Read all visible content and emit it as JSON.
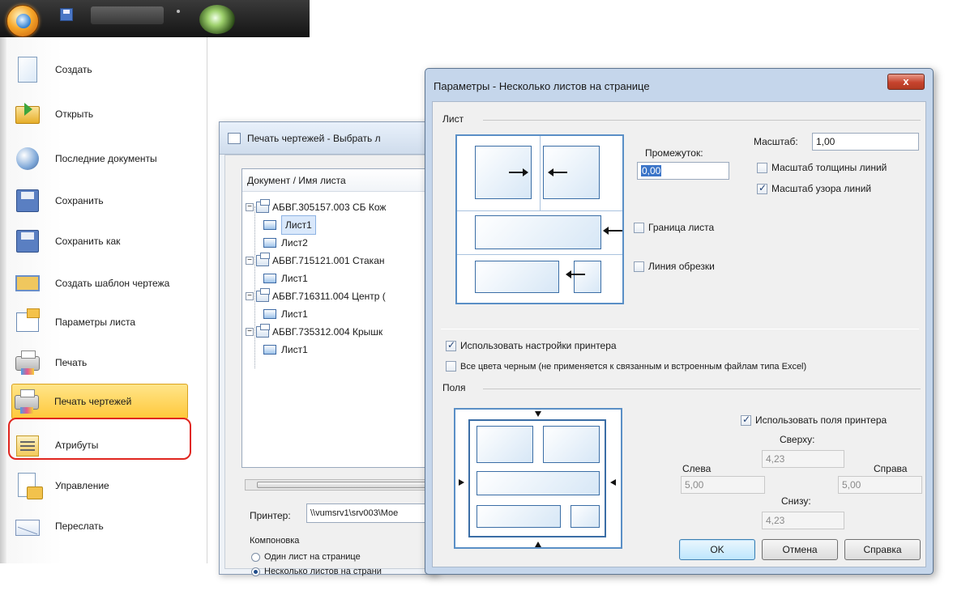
{
  "quick_access": {
    "icons": [
      "app-button-icon",
      "save-icon",
      "undo-icon",
      "dropdown-icon",
      "globe-icon"
    ]
  },
  "app_menu": {
    "items": [
      {
        "label": "Создать",
        "icon": "new-document-icon"
      },
      {
        "label": "Открыть",
        "icon": "open-folder-icon"
      },
      {
        "label": "Последние документы",
        "icon": "recent-documents-icon"
      },
      {
        "label": "Сохранить",
        "icon": "save-icon"
      },
      {
        "label": "Сохранить как",
        "icon": "save-as-icon"
      },
      {
        "label": "Создать шаблон чертежа",
        "icon": "template-icon"
      },
      {
        "label": "Параметры листа",
        "icon": "sheet-settings-icon"
      },
      {
        "label": "Печать",
        "icon": "printer-icon"
      },
      {
        "label": "Печать чертежей",
        "icon": "print-drawings-icon",
        "selected": true
      },
      {
        "label": "Атрибуты",
        "icon": "attributes-icon"
      },
      {
        "label": "Управление",
        "icon": "manage-icon"
      },
      {
        "label": "Переслать",
        "icon": "send-icon"
      }
    ],
    "highlight_color": "#e0261f"
  },
  "print_dialog": {
    "title": "Печать чертежей - Выбрать л",
    "tree_header": "Документ / Имя листа",
    "tree": [
      {
        "label": "АБВГ.305157.003 СБ Кож",
        "level": 0
      },
      {
        "label": "Лист1",
        "level": 1,
        "selected": true
      },
      {
        "label": "Лист2",
        "level": 1
      },
      {
        "label": "АБВГ.715121.001 Стакан",
        "level": 0
      },
      {
        "label": "Лист1",
        "level": 1
      },
      {
        "label": "АБВГ.716311.004 Центр (",
        "level": 0
      },
      {
        "label": "Лист1",
        "level": 1
      },
      {
        "label": "АБВГ.735312.004 Крышк",
        "level": 0
      },
      {
        "label": "Лист1",
        "level": 1
      }
    ],
    "printer_label": "Принтер:",
    "printer_value": "\\\\vumsrv1\\srv003\\Moe",
    "layout_label": "Компоновка",
    "layout_options": [
      {
        "label": "Один лист на странице",
        "checked": false
      },
      {
        "label": "Несколько листов на страни",
        "checked": true
      }
    ]
  },
  "param_dialog": {
    "title": "Параметры - Несколько листов на странице",
    "close_label": "x",
    "sheet_group": "Лист",
    "gap_label": "Промежуток:",
    "gap_value": "0,00",
    "scale_label": "Масштаб:",
    "scale_value": "1,00",
    "check_line_weight": {
      "label": "Масштаб толщины линий",
      "checked": false
    },
    "check_line_pattern": {
      "label": "Масштаб узора линий",
      "checked": true
    },
    "check_sheet_border": {
      "label": "Граница листа",
      "checked": false
    },
    "check_trim_line": {
      "label": "Линия обрезки",
      "checked": false
    },
    "check_printer_settings": {
      "label": "Использовать настройки принтера",
      "checked": true
    },
    "check_all_black": {
      "label": "Все цвета черным (не применяется к связанным и встроенным файлам типа Excel)",
      "checked": false
    },
    "margins_group": "Поля",
    "check_printer_margins": {
      "label": "Использовать поля принтера",
      "checked": true
    },
    "top_label": "Сверху:",
    "top_value": "4,23",
    "left_label": "Слева",
    "left_value": "5,00",
    "right_label": "Справа",
    "right_value": "5,00",
    "bottom_label": "Снизу:",
    "bottom_value": "4,23",
    "ok_label": "OK",
    "cancel_label": "Отмена",
    "help_label": "Справка"
  }
}
